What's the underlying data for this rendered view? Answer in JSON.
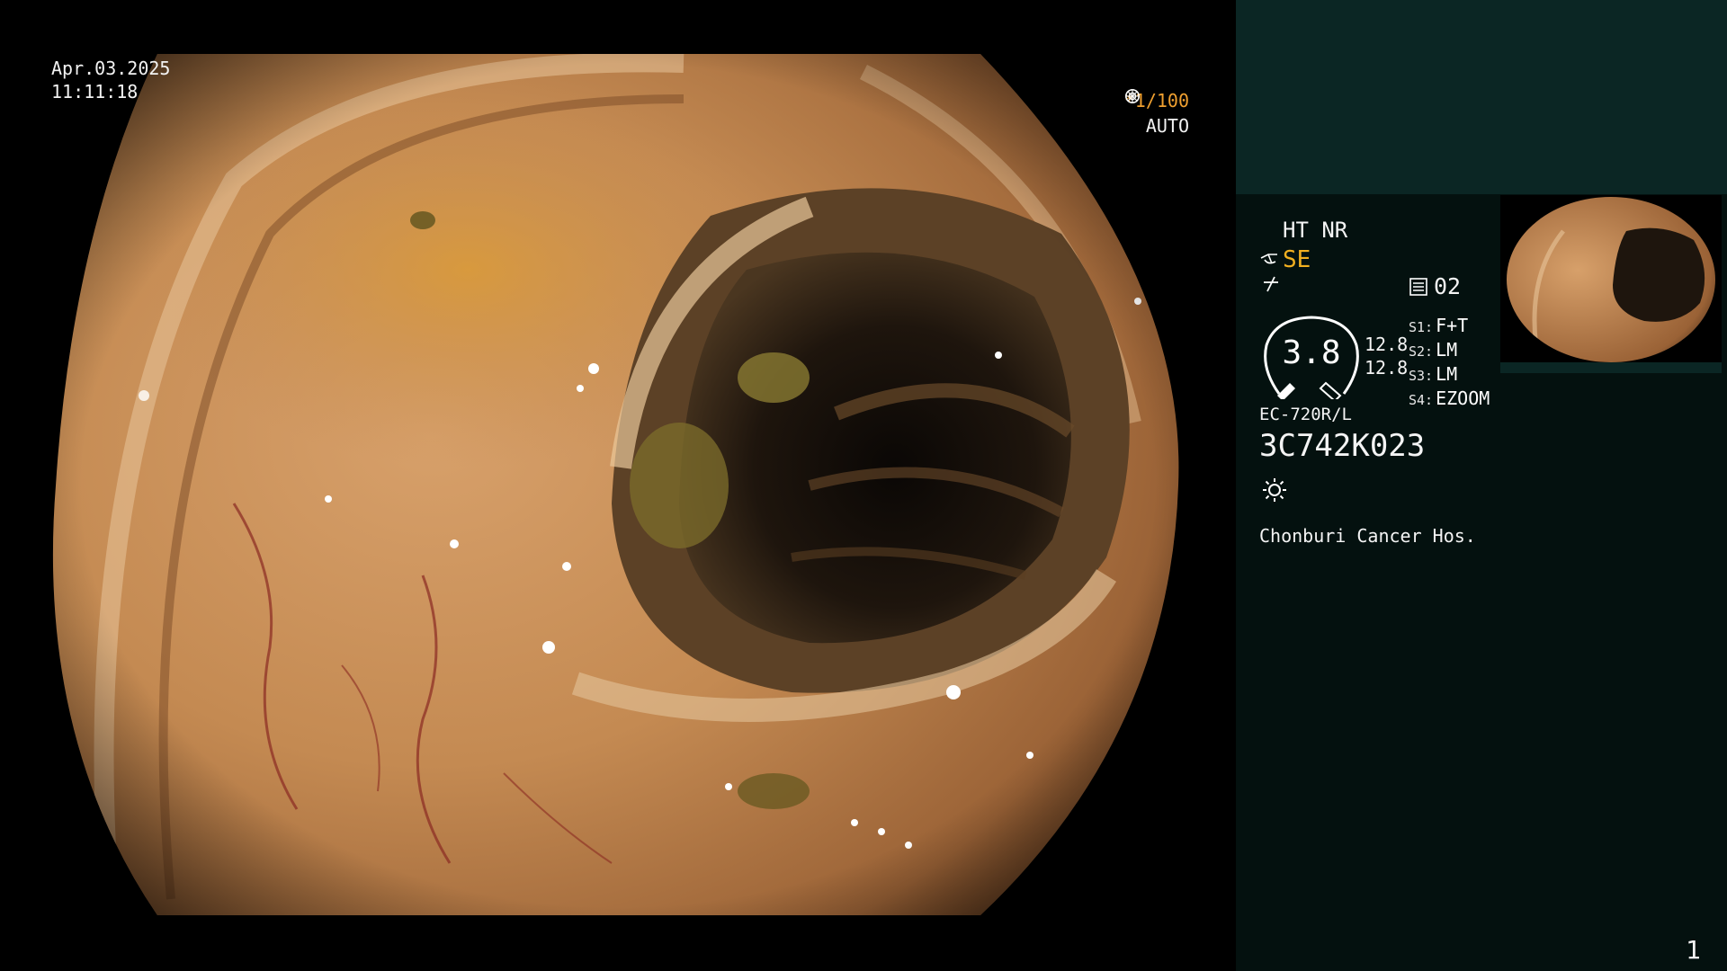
{
  "overlay": {
    "date": "Apr.03.2025",
    "time": "11:11:18",
    "shutter": "*1/100",
    "shutter_icon": "aperture-icon",
    "iris_mode": "AUTO",
    "iris_icon": "iris-icon"
  },
  "info": {
    "modes": "HT NR",
    "se_label": "SE",
    "record_value": "02",
    "gauge_value": "3.8",
    "gauge_upper": "12.8",
    "gauge_lower": "12.8",
    "slots": [
      {
        "key": "S1:",
        "value": "F+T"
      },
      {
        "key": "S2:",
        "value": "LM"
      },
      {
        "key": "S3:",
        "value": "LM"
      },
      {
        "key": "S4:",
        "value": "EZOOM"
      }
    ],
    "scope_model": "EC-720R/L",
    "scope_serial": "3C742K023",
    "light_icon": "light-icon",
    "hospital": "Chonburi Cancer Hos.",
    "page_number": "1"
  },
  "colors": {
    "panel_bg": "#04110f",
    "panel_top": "#0b2624",
    "accent_orange": "#f0a030"
  }
}
